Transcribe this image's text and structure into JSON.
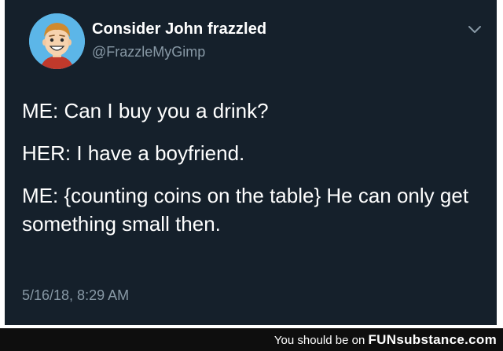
{
  "tweet": {
    "display_name": "Consider John frazzled",
    "handle": "@FrazzleMyGimp",
    "lines": [
      "ME: Can I buy you a drink?",
      "HER: I have a boyfriend.",
      "ME: {counting coins on the table} He can only get something small then."
    ],
    "timestamp": "5/16/18, 8:29 AM",
    "more_icon": "chevron-down-icon",
    "avatar_icon": "cartoon-face-avatar"
  },
  "watermark": {
    "prefix": "You should be on",
    "brand": "FUNsubstance.com"
  },
  "colors": {
    "card_background": "#15202b",
    "secondary_text": "#8899a6",
    "avatar_background": "#5cb6e8"
  }
}
